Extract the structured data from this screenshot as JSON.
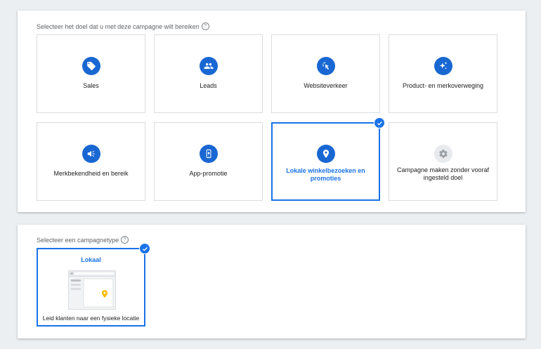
{
  "goal_section": {
    "label": "Selecteer het doel dat u met deze campagne wilt bereiken",
    "help_icon": "?",
    "cards": [
      {
        "label": "Sales",
        "icon": "tag-icon"
      },
      {
        "label": "Leads",
        "icon": "people-icon"
      },
      {
        "label": "Websiteverkeer",
        "icon": "cursor-click-icon"
      },
      {
        "label": "Product- en merkoverweging",
        "icon": "sparkle-icon"
      },
      {
        "label": "Merkbekendheid en bereik",
        "icon": "megaphone-icon"
      },
      {
        "label": "App-promotie",
        "icon": "phone-icon"
      },
      {
        "label": "Lokale winkelbezoeken en promoties",
        "icon": "location-pin-icon",
        "selected": true
      },
      {
        "label": "Campagne maken zonder vooraf ingesteld doel",
        "icon": "gear-icon"
      }
    ]
  },
  "type_section": {
    "label": "Selecteer een campagnetype",
    "help_icon": "?",
    "card": {
      "title": "Lokaal",
      "caption": "Leid klanten naar een fysieke locatie",
      "selected": true
    }
  },
  "colors": {
    "accent": "#1a73e8",
    "icon_bg": "#1967d2",
    "muted_icon_bg": "#e8eaed",
    "page_bg": "#eceff1"
  }
}
